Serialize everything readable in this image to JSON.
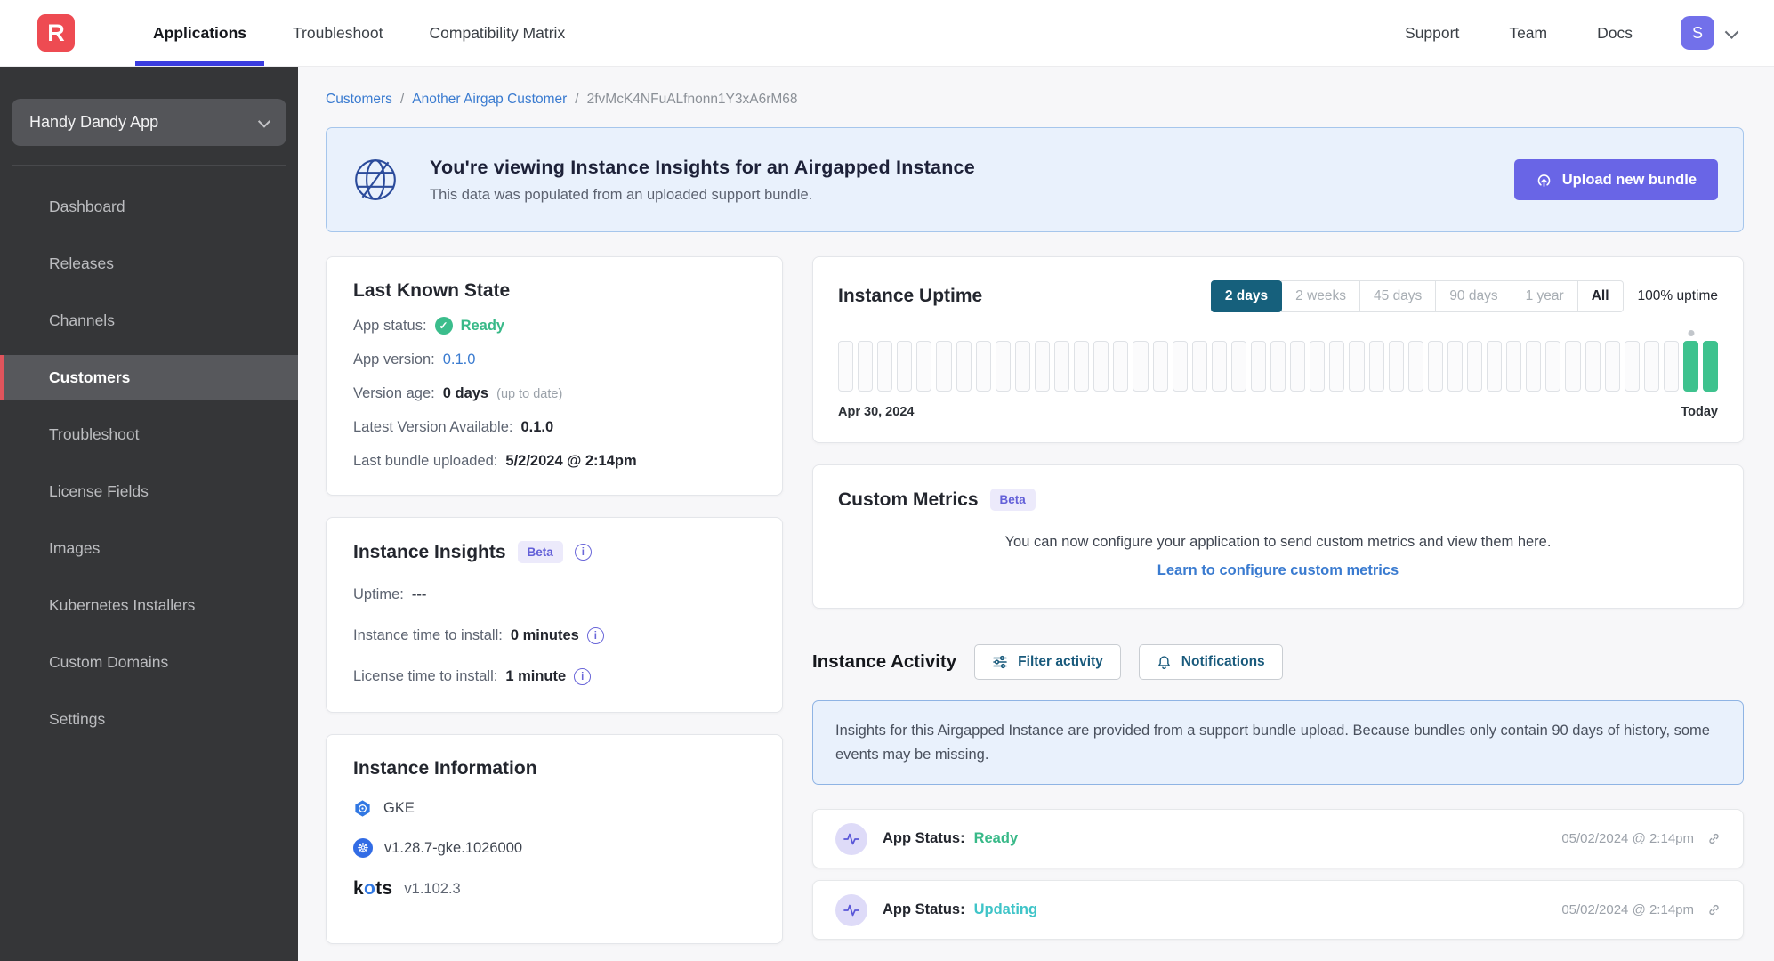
{
  "topnav": {
    "logo_letter": "R",
    "items": [
      {
        "label": "Applications",
        "state": "active"
      },
      {
        "label": "Troubleshoot",
        "state": "default"
      },
      {
        "label": "Compatibility Matrix",
        "state": "default"
      }
    ],
    "right_items": [
      "Support",
      "Team",
      "Docs"
    ],
    "avatar_initial": "S"
  },
  "sidebar": {
    "app_selector_label": "Handy Dandy App",
    "items": [
      {
        "label": "Dashboard",
        "state": "default"
      },
      {
        "label": "Releases",
        "state": "default"
      },
      {
        "label": "Channels",
        "state": "default"
      },
      {
        "label": "Customers",
        "state": "active"
      },
      {
        "label": "Troubleshoot",
        "state": "default"
      },
      {
        "label": "License Fields",
        "state": "default"
      },
      {
        "label": "Images",
        "state": "default"
      },
      {
        "label": "Kubernetes Installers",
        "state": "default"
      },
      {
        "label": "Custom Domains",
        "state": "default"
      },
      {
        "label": "Settings",
        "state": "default"
      }
    ]
  },
  "breadcrumb": {
    "crumbs": [
      {
        "label": "Customers",
        "type": "link"
      },
      {
        "label": "Another Airgap Customer",
        "type": "link"
      },
      {
        "label": "2fvMcK4NFuALfnonn1Y3xA6rM68",
        "type": "current"
      }
    ]
  },
  "banner": {
    "title": "You're viewing Instance Insights for an Airgapped Instance",
    "subtitle": "This data was populated from an uploaded support bundle.",
    "button_label": "Upload new bundle"
  },
  "cards": {
    "last_known_state": {
      "title": "Last Known State",
      "app_status_label": "App status:",
      "app_status_value": "Ready",
      "app_version_label": "App version:",
      "app_version_value": "0.1.0",
      "version_age_label": "Version age:",
      "version_age_value": "0 days",
      "version_age_note": "(up to date)",
      "latest_version_label": "Latest Version Available:",
      "latest_version_value": "0.1.0",
      "last_bundle_label": "Last bundle uploaded:",
      "last_bundle_value": "5/2/2024 @ 2:14pm"
    },
    "instance_insights": {
      "title": "Instance Insights",
      "beta_label": "Beta",
      "uptime_label": "Uptime:",
      "uptime_value": "---",
      "instance_install_label": "Instance time to install:",
      "instance_install_value": "0 minutes",
      "license_install_label": "License time to install:",
      "license_install_value": "1 minute"
    },
    "instance_information": {
      "title": "Instance Information",
      "distribution": "GKE",
      "k8s_version": "v1.28.7-gke.1026000",
      "kots_label": "kots",
      "kots_version": "v1.102.3"
    },
    "instance_uptime": {
      "title": "Instance Uptime",
      "ranges": [
        {
          "label": "2 days",
          "style": "active"
        },
        {
          "label": "2 weeks",
          "style": "muted"
        },
        {
          "label": "45 days",
          "style": "muted"
        },
        {
          "label": "90 days",
          "style": "muted"
        },
        {
          "label": "1 year",
          "style": "muted"
        },
        {
          "label": "All",
          "style": "plain"
        }
      ],
      "summary": "100% uptime",
      "bars": {
        "count": 45,
        "up_last": 2,
        "marker_index": 43
      },
      "start_label": "Apr 30, 2024",
      "end_label": "Today"
    },
    "custom_metrics": {
      "title": "Custom Metrics",
      "beta_label": "Beta",
      "body": "You can now configure your application to send custom metrics and view them here.",
      "link_label": "Learn to configure custom metrics"
    },
    "instance_activity": {
      "title": "Instance Activity",
      "filter_button_label": "Filter activity",
      "notifications_button_label": "Notifications",
      "note": "Insights for this Airgapped Instance are provided from a support bundle upload. Because bundles only contain 90 days of history, some events may be missing.",
      "events": [
        {
          "label": "App Status:",
          "status": "Ready",
          "status_style": "green",
          "timestamp": "05/02/2024 @ 2:14pm"
        },
        {
          "label": "App Status:",
          "status": "Updating",
          "status_style": "teal",
          "timestamp": "05/02/2024 @ 2:14pm"
        }
      ]
    }
  },
  "colors": {
    "brand_red": "#ee4b52",
    "accent_indigo": "#6965e6",
    "nav_underline": "#3a3cdf",
    "link_blue": "#3a7bd0",
    "success_green": "#38b988",
    "updating_teal": "#3fc4c8",
    "range_active_teal": "#16607c",
    "uptime_bar_green": "#3ec28e",
    "sidebar_active_red": "#e0545c"
  }
}
